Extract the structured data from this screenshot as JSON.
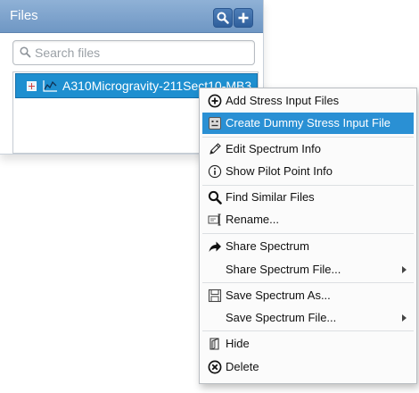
{
  "panel": {
    "title": "Files",
    "search_placeholder": "Search files",
    "selected_file": "A310Microgravity-211Sect10-MB3"
  },
  "menu": {
    "items": [
      {
        "label": "Add Stress Input Files",
        "icon": "plus-circle-icon"
      },
      {
        "label": "Create Dummy Stress Input File",
        "icon": "dummy-file-icon",
        "highlighted": true
      },
      {
        "label": "Edit Spectrum Info",
        "icon": "pencil-icon"
      },
      {
        "label": "Show Pilot Point Info",
        "icon": "info-icon"
      },
      {
        "label": "Find Similar Files",
        "icon": "search-icon"
      },
      {
        "label": "Rename...",
        "icon": "rename-icon"
      },
      {
        "label": "Share Spectrum",
        "icon": "share-arrow-icon"
      },
      {
        "label": "Share Spectrum File...",
        "submenu": true
      },
      {
        "label": "Save Spectrum As...",
        "icon": "floppy-icon"
      },
      {
        "label": "Save Spectrum File...",
        "submenu": true
      },
      {
        "label": "Hide",
        "icon": "hide-icon"
      },
      {
        "label": "Delete",
        "icon": "delete-icon"
      }
    ]
  },
  "colors": {
    "header": "#7aa0cb",
    "selection": "#1e8fd0",
    "menu_highlight": "#2a90d4"
  }
}
